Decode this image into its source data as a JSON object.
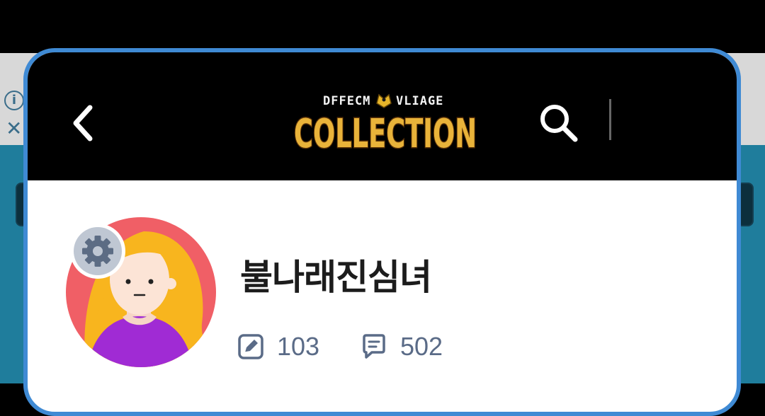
{
  "header": {
    "logo": {
      "top_text": "DFFECM",
      "top_text_right": "VLIAGE",
      "main_text": "COLLECTION"
    }
  },
  "profile": {
    "username": "불나래진심녀",
    "post_count": "103",
    "comment_count": "502"
  },
  "colors": {
    "popup_border": "#3f8ad4",
    "header_bg": "#000000",
    "stat_text": "#5a6b87",
    "avatar_bg": "#f05f66",
    "avatar_hair": "#f8b51e",
    "avatar_shirt": "#a02bd4"
  },
  "icons": [
    "back-chevron-icon",
    "search-icon",
    "gear-icon",
    "edit-icon",
    "comment-icon"
  ]
}
